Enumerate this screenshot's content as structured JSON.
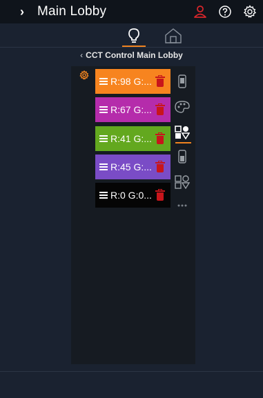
{
  "header": {
    "title": "Main Lobby",
    "expand_glyph": "›",
    "icons": [
      "user-alert-icon",
      "help-icon",
      "settings-icon"
    ]
  },
  "tabs": [
    {
      "name": "lights-tab",
      "icon": "lightbulb-icon",
      "active": true
    },
    {
      "name": "rooms-tab",
      "icon": "home-icon",
      "active": false
    }
  ],
  "breadcrumb": {
    "back_glyph": "‹",
    "label": "CCT Control Main Lobby"
  },
  "presets": [
    {
      "label": "R:98 G:...",
      "color": "#f7841f",
      "text_color": "#ffffff"
    },
    {
      "label": "R:67 G:...",
      "color": "#b52cab",
      "text_color": "#ffffff"
    },
    {
      "label": "R:41 G:...",
      "color": "#63a81f",
      "text_color": "#ffffff"
    },
    {
      "label": "R:45 G:...",
      "color": "#7a4cc6",
      "text_color": "#ffffff"
    },
    {
      "label": "R:0 G:0...",
      "color": "#050505",
      "text_color": "#ffffff"
    }
  ],
  "tools": [
    "remote-icon",
    "palette-icon",
    "color-scenes-icon",
    "device-icon",
    "scene-edit-icon",
    "more-icon"
  ],
  "colors": {
    "accent": "#f0831f",
    "alert": "#d8262b",
    "trash": "#c8151b",
    "background": "#1a2230",
    "panel": "#161b22"
  }
}
